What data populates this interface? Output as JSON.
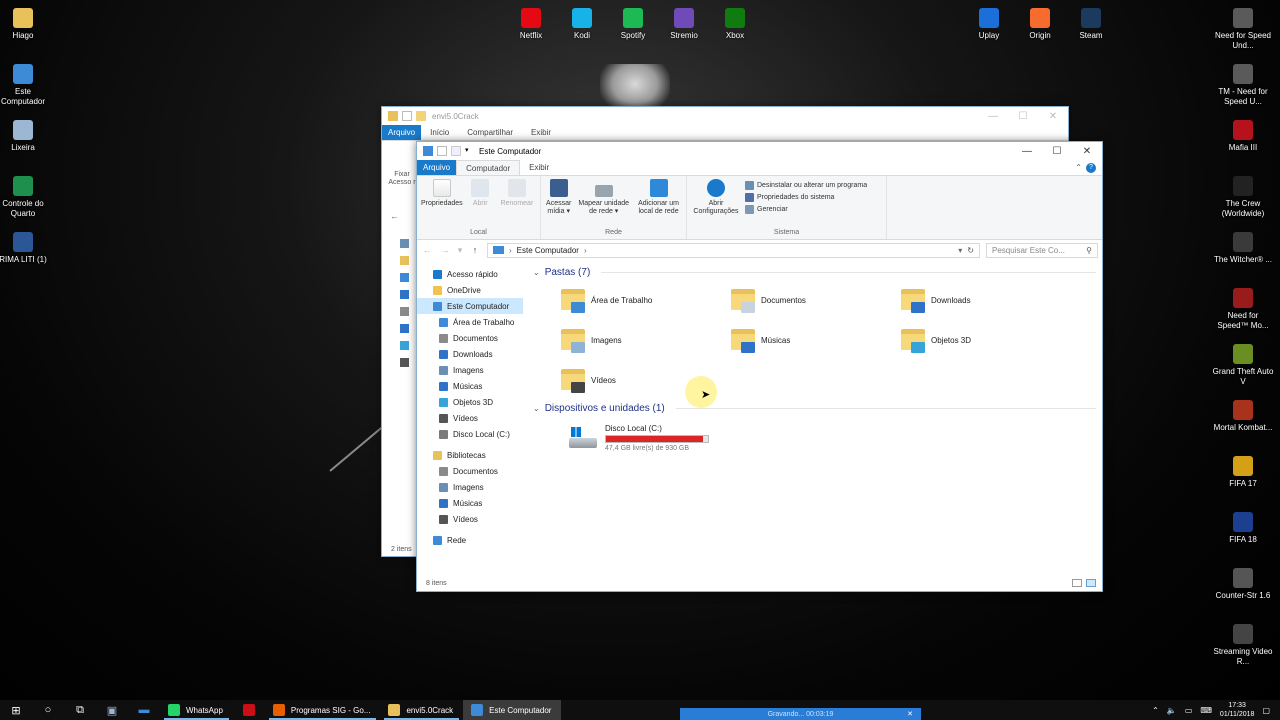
{
  "desktop": {
    "left_icons": [
      {
        "label": "Hiago",
        "color": "#e8c15a"
      },
      {
        "label": "Este Computador",
        "color": "#3d8ad6"
      },
      {
        "label": "Lixeira",
        "color": "#9bb7d4"
      },
      {
        "label": "Controle do Quarto",
        "color": "#1f8f4e"
      },
      {
        "label": "RIMA LITI (1)",
        "color": "#2b5797"
      }
    ],
    "top_icons": [
      {
        "label": "Netflix",
        "color": "#e50914"
      },
      {
        "label": "Kodi",
        "color": "#17b2e7"
      },
      {
        "label": "Spotify",
        "color": "#1db954"
      },
      {
        "label": "Stremio",
        "color": "#6e4bb8"
      },
      {
        "label": "Xbox",
        "color": "#107c10"
      },
      {
        "label": "Uplay",
        "color": "#1b6fd8"
      },
      {
        "label": "Origin",
        "color": "#f56c2d"
      },
      {
        "label": "Steam",
        "color": "#1b3a5e"
      }
    ],
    "right_icons": [
      {
        "label": "Need for Speed Und...",
        "color": "#5a5a5a"
      },
      {
        "label": "TM - Need for Speed U...",
        "color": "#5a5a5a"
      },
      {
        "label": "Mafia III",
        "color": "#b5121b"
      },
      {
        "label": "The Crew (Worldwide)",
        "color": "#222222"
      },
      {
        "label": "The Witcher® ...",
        "color": "#3a3a3a"
      },
      {
        "label": "Need for Speed™ Mo...",
        "color": "#9a1b1b"
      },
      {
        "label": "Grand Theft Auto V",
        "color": "#6b8e23"
      },
      {
        "label": "Mortal Kombat...",
        "color": "#a8321c"
      },
      {
        "label": "FIFA 17",
        "color": "#d4a017"
      },
      {
        "label": "FIFA 18",
        "color": "#1d3f8f"
      },
      {
        "label": "Counter-Str 1.6",
        "color": "#555555"
      },
      {
        "label": "Streaming Video R...",
        "color": "#444444"
      }
    ]
  },
  "back_window": {
    "title": "envi5.0Crack",
    "tabs": [
      "Arquivo",
      "Início",
      "Compartilhar",
      "Exibir"
    ],
    "ribbon_peek": "Fixar Acesso r",
    "status": "2 itens"
  },
  "window": {
    "title": "Este Computador",
    "tabs": {
      "file": "Arquivo",
      "computer": "Computador",
      "view": "Exibir"
    },
    "ribbon": {
      "local": {
        "label": "Local",
        "buttons": [
          "Propriedades",
          "Abrir",
          "Renomear"
        ]
      },
      "rede": {
        "label": "Rede",
        "buttons": [
          "Acessar mídia ▾",
          "Mapear unidade de rede ▾",
          "Adicionar um local de rede"
        ]
      },
      "sistema": {
        "label": "Sistema",
        "open_settings": "Abrir Configurações",
        "commands": [
          "Desinstalar ou alterar um programa",
          "Propriedades do sistema",
          "Gerenciar"
        ]
      }
    },
    "address": {
      "path": "Este Computador",
      "search_placeholder": "Pesquisar Este Co..."
    },
    "nav": [
      {
        "label": "Acesso rápido",
        "color": "#1979ca",
        "indent": 1
      },
      {
        "label": "OneDrive",
        "color": "#f2c14e",
        "indent": 1
      },
      {
        "label": "Este Computador",
        "color": "#3d8ad6",
        "indent": 1,
        "selected": true
      },
      {
        "label": "Área de Trabalho",
        "color": "#3d8ad6",
        "indent": 2
      },
      {
        "label": "Documentos",
        "color": "#8a8a8a",
        "indent": 2
      },
      {
        "label": "Downloads",
        "color": "#2f73c9",
        "indent": 2
      },
      {
        "label": "Imagens",
        "color": "#6a8fb5",
        "indent": 2
      },
      {
        "label": "Músicas",
        "color": "#2f73c9",
        "indent": 2
      },
      {
        "label": "Objetos 3D",
        "color": "#36a3d9",
        "indent": 2
      },
      {
        "label": "Vídeos",
        "color": "#555555",
        "indent": 2
      },
      {
        "label": "Disco Local (C:)",
        "color": "#7a7a7a",
        "indent": 2
      },
      {
        "label": "Bibliotecas",
        "color": "#e8c15a",
        "indent": 1
      },
      {
        "label": "Documentos",
        "color": "#8a8a8a",
        "indent": 2
      },
      {
        "label": "Imagens",
        "color": "#6a8fb5",
        "indent": 2
      },
      {
        "label": "Músicas",
        "color": "#2f73c9",
        "indent": 2
      },
      {
        "label": "Vídeos",
        "color": "#555555",
        "indent": 2
      },
      {
        "label": "Rede",
        "color": "#3d8ad6",
        "indent": 1
      }
    ],
    "folders_header": "Pastas (7)",
    "folders": [
      {
        "label": "Área de Trabalho",
        "badge": "#3d8ad6"
      },
      {
        "label": "Documentos",
        "badge": "#c7d3df"
      },
      {
        "label": "Downloads",
        "badge": "#2f73c9"
      },
      {
        "label": "Imagens",
        "badge": "#8fb3d6"
      },
      {
        "label": "Músicas",
        "badge": "#2f73c9"
      },
      {
        "label": "Objetos 3D",
        "badge": "#36a3d9"
      },
      {
        "label": "Vídeos",
        "badge": "#444444"
      }
    ],
    "devices_header": "Dispositivos e unidades (1)",
    "drive": {
      "label": "Disco Local (C:)",
      "free": "47,4 GB livre(s) de 930 GB",
      "used_fraction": 0.95
    },
    "status": "8 itens"
  },
  "taskbar": {
    "apps": [
      {
        "label": "WhatsApp",
        "color": "#25d366",
        "state": "running"
      },
      {
        "label": "",
        "color": "#cc0f16",
        "state": "idle"
      },
      {
        "label": "Programas SIG - Go...",
        "color": "#e66000",
        "state": "running"
      },
      {
        "label": "envi5.0Crack",
        "color": "#e8c15a",
        "state": "running"
      },
      {
        "label": "Este Computador",
        "color": "#3d8ad6",
        "state": "active"
      }
    ],
    "time": "17:33",
    "date": "01/11/2018"
  },
  "recorder": {
    "label": "Gravando... 00:03:19"
  }
}
